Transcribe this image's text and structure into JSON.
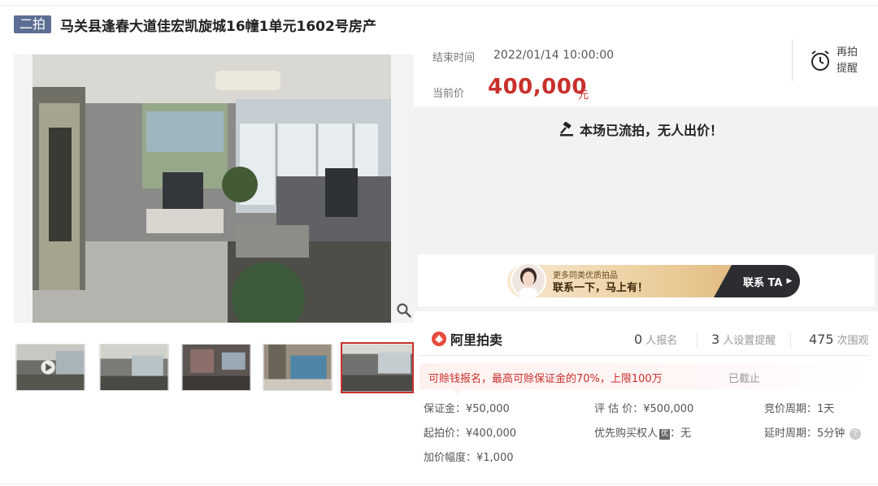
{
  "header": {
    "round_tag": "二拍",
    "title": "马关县逢春大道佳宏凯旋城16幢1单元1602号房产"
  },
  "auction": {
    "end_time_label": "结束时间",
    "end_time_value": "2022/01/14 10:00:00",
    "price_label": "当前价",
    "price_value": "400,000",
    "price_unit": "元",
    "remind_label": "再拍\n提醒",
    "status_message": "本场已流拍，无人出价！"
  },
  "contact": {
    "small_text": "更多同类优质拍品",
    "big_text": "联系一下，马上有！",
    "button_label": "联系 TA"
  },
  "stats": {
    "logo_text": "阿里拍卖",
    "signups_value": "0",
    "signups_label": "人报名",
    "reminders_value": "3",
    "reminders_label": "人设置提醒",
    "views_value": "475",
    "views_label": "次围观"
  },
  "notice": {
    "text": "可赊钱报名，最高可赊保证金的70%，上限100万",
    "status": "已截止"
  },
  "params": {
    "deposit": "保证金：¥50,000",
    "appraisal": "评 估 价：¥500,000",
    "cycle": "竞价周期：1天",
    "start_price": "起拍价：¥400,000",
    "priority_label": "优先购买权人",
    "priority_tag": "优",
    "priority_value": "：无",
    "delay": "延时周期：5分钟",
    "increment": "加价幅度：¥1,000"
  },
  "icons": {
    "zoom": "zoom-icon",
    "alarm": "alarm-clock-icon",
    "hammer": "auction-hammer-icon",
    "help": "help-icon",
    "play": "play-icon"
  },
  "colors": {
    "accent": "#c9302c",
    "tag_bg": "#5c6e93"
  }
}
